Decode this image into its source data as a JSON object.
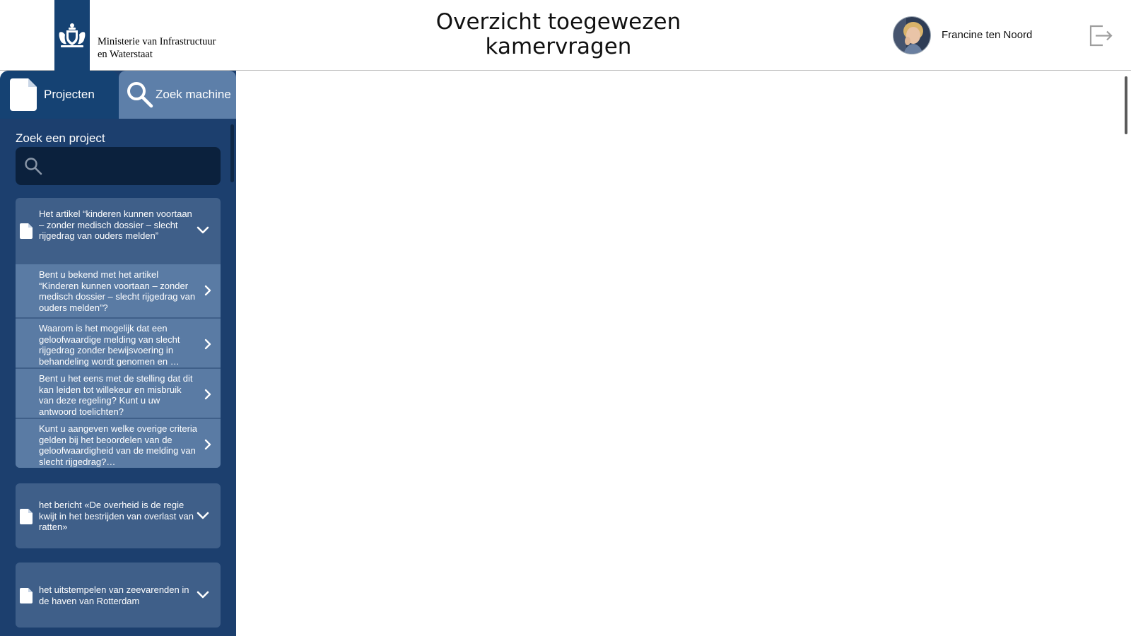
{
  "header": {
    "ministry_line1": "Ministerie van Infrastructuur",
    "ministry_line2": "en Waterstaat",
    "title_line1": "Overzicht toegewezen",
    "title_line2": "kamervragen",
    "user_name": "Francine ten Noord",
    "logout_icon": "logout-icon"
  },
  "tabs": {
    "projects_label": "Projecten",
    "search_label": "Zoek machine"
  },
  "search": {
    "label": "Zoek een project",
    "value": "",
    "placeholder": ""
  },
  "projects": [
    {
      "title": "Het artikel “kinderen kunnen voortaan – zonder medisch dossier – slecht rijgedrag van ouders melden”",
      "expanded": true,
      "questions": [
        "Bent u bekend met het artikel “Kinderen kunnen voortaan – zonder medisch dossier – slecht rijgedrag van ouders melden”?",
        "Waarom is het mogelijk dat een geloofwaardige melding van slecht rijgedrag zonder bewijsvoering in behandeling wordt genomen en …",
        "Bent u het eens met de stelling dat dit kan leiden tot willekeur en misbruik van deze regeling? Kunt u uw antwoord toelichten?",
        "Kunt u aangeven welke overige criteria gelden bij het beoordelen van de geloofwaardigheid van de melding van slecht rijgedrag?…"
      ]
    },
    {
      "title": "het bericht «De overheid is de regie kwijt in het bestrijden van overlast van ratten»",
      "expanded": false
    },
    {
      "title": "het uitstempelen van zeevarenden in de haven van Rotterdam",
      "expanded": false
    }
  ],
  "colors": {
    "brand_blue": "#154273",
    "sidebar_bg": "#1c3f6e",
    "card_bg": "#3f5f89",
    "question_bg": "#5a7ba4",
    "search_tab_bg": "#5d7fa9"
  }
}
